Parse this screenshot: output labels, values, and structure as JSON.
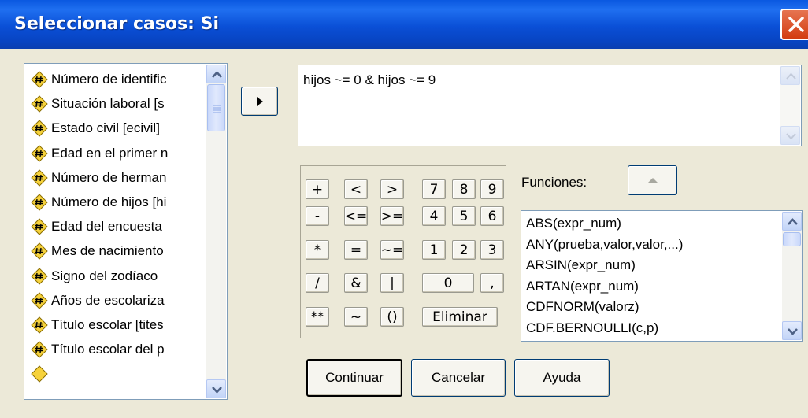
{
  "window": {
    "title": "Seleccionar casos: Si"
  },
  "variables": {
    "items": [
      "Número de identific",
      "Situación laboral [s",
      "Estado civil [ecivil]",
      "Edad en el primer n",
      "Número de herman",
      "Número de hijos [hi",
      "Edad del encuesta",
      "Mes de nacimiento",
      "Signo del zodíaco",
      "Años de escolariza",
      "Título escolar [tites",
      "Título escolar del p"
    ],
    "icon": "numeric-variable-icon"
  },
  "move_button": {
    "icon": "arrow-right-icon"
  },
  "expression": {
    "value": "hijos ~= 0 & hijos ~= 9"
  },
  "keypad": {
    "row1": [
      "+",
      "<",
      ">",
      "7",
      "8",
      "9"
    ],
    "row2": [
      "-",
      "<=",
      ">=",
      "4",
      "5",
      "6"
    ],
    "row3": [
      "*",
      "=",
      "~=",
      "1",
      "2",
      "3"
    ],
    "row4": [
      "/",
      "&",
      "|",
      "0",
      ","
    ],
    "row5": [
      "**",
      "~",
      "()",
      "Eliminar"
    ]
  },
  "functions": {
    "label": "Funciones:",
    "items": [
      "ABS(expr_num)",
      "ANY(prueba,valor,valor,...)",
      "ARSIN(expr_num)",
      "ARTAN(expr_num)",
      "CDFNORM(valorz)",
      "CDF.BERNOULLI(c,p)"
    ]
  },
  "buttons": {
    "continue": "Continuar",
    "cancel": "Cancelar",
    "help": "Ayuda"
  },
  "colors": {
    "titlebar": "#0a58e0",
    "dialog": "#ece9d8",
    "close": "#d33c10"
  }
}
